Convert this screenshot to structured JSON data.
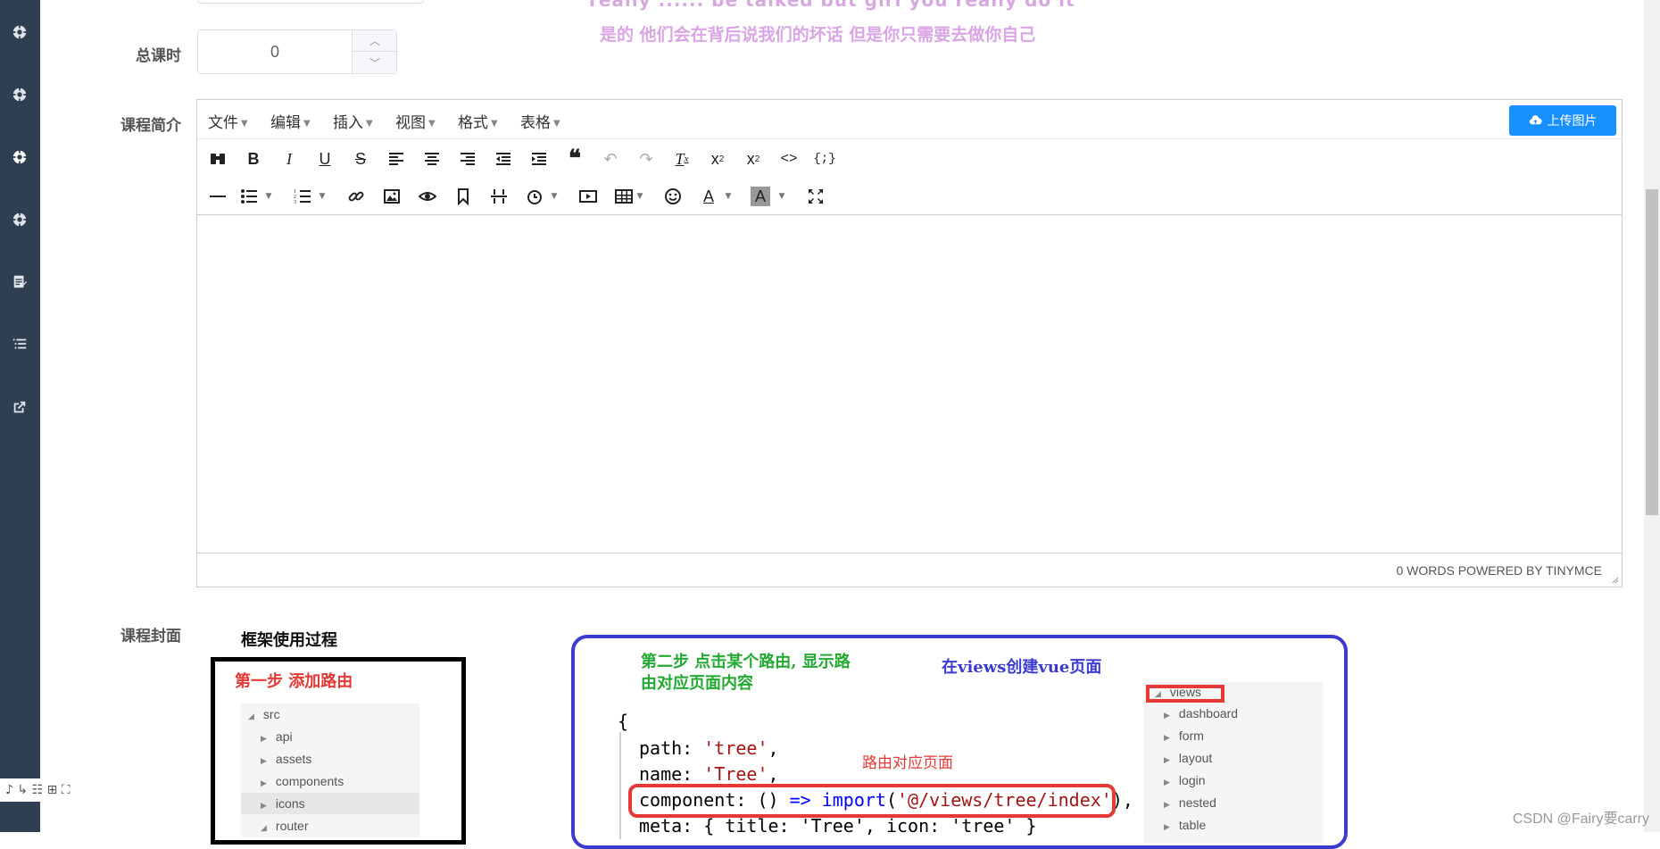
{
  "banner": {
    "top_text": "really ...... be talked but girl you really do it",
    "sub_text": "是的 他们会在背后说我们的坏话 但是你只需要去做你自己"
  },
  "form": {
    "total_hours_label": "总课时",
    "total_hours_value": "0",
    "intro_label": "课程简介",
    "cover_label": "课程封面"
  },
  "editor": {
    "menus": [
      "文件",
      "编辑",
      "插入",
      "视图",
      "格式",
      "表格"
    ],
    "upload_label": "上传图片",
    "status": "0 WORDS POWERED BY TINYMCE"
  },
  "cover": {
    "title": "框架使用过程",
    "step1": "第一步  添加路由",
    "tree1": [
      "src",
      "api",
      "assets",
      "components",
      "icons",
      "router"
    ],
    "step2_line1": "第二步  点击某个路由, 显示路",
    "step2_line2": "由对应页面内容",
    "step2_right": "在views创建vue页面",
    "route_note": "路由对应页面",
    "code": {
      "brace": "{",
      "path_key": "path: ",
      "path_val": "'tree'",
      "name_key": "name: ",
      "name_val": "'Tree'",
      "comp_key": "component: () ",
      "comp_arrow": "=>",
      "comp_import": " import",
      "comp_path": "'@/views/tree/index'",
      "comp_end": "),",
      "meta_line": "meta: { title: 'Tree', icon: 'tree' }"
    },
    "tree2": [
      "views",
      "dashboard",
      "form",
      "layout",
      "login",
      "nested",
      "table"
    ]
  },
  "float_tools": "♪ ↳ ☷ ⊞ ⛶",
  "watermark": "CSDN @Fairy要carry",
  "colors": {
    "sidebar": "#2f3e50",
    "upload": "#1890ff",
    "accent_red": "#e53935"
  }
}
